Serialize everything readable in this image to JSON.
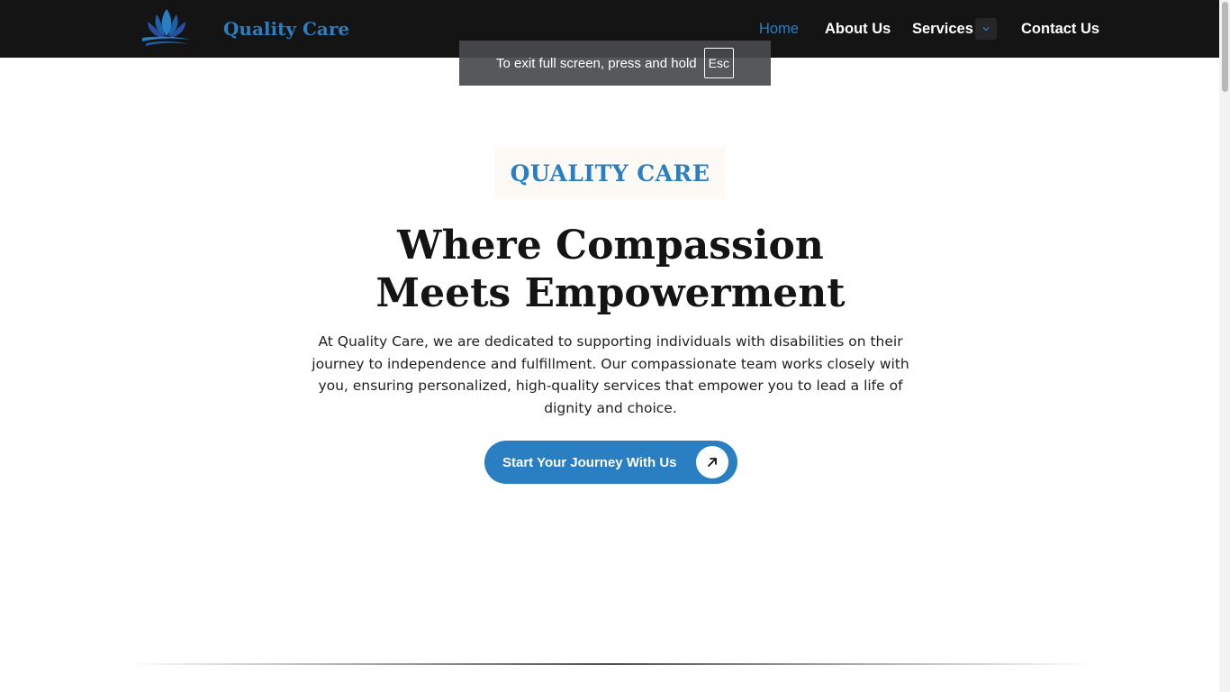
{
  "header": {
    "brand": "Quality Care",
    "logo_icon": "lotus-icon",
    "nav": [
      {
        "label": "Home",
        "active": true
      },
      {
        "label": "About Us",
        "active": false
      },
      {
        "label": "Services",
        "active": false,
        "has_dropdown": true
      },
      {
        "label": "Contact Us",
        "active": false
      }
    ]
  },
  "fullscreen_notice": {
    "text": "To exit full screen, press and hold",
    "key": "Esc"
  },
  "hero": {
    "eyebrow": "QUALITY CARE",
    "title_line1": "Where Compassion",
    "title_line2": "Meets Empowerment",
    "description": "At Quality Care, we are dedicated to supporting individuals with disabilities on their journey to independence and fulfillment. Our compassionate team works closely with you, ensuring personalized, high-quality services that empower you to lead a life of dignity and choice.",
    "cta_label": "Start Your Journey With Us",
    "cta_icon": "arrow-up-right-icon"
  },
  "colors": {
    "accent": "#2a7fc2",
    "header_bg": "#141414",
    "heading_text": "#141414",
    "eyebrow_bg": "#fdf9f4"
  }
}
